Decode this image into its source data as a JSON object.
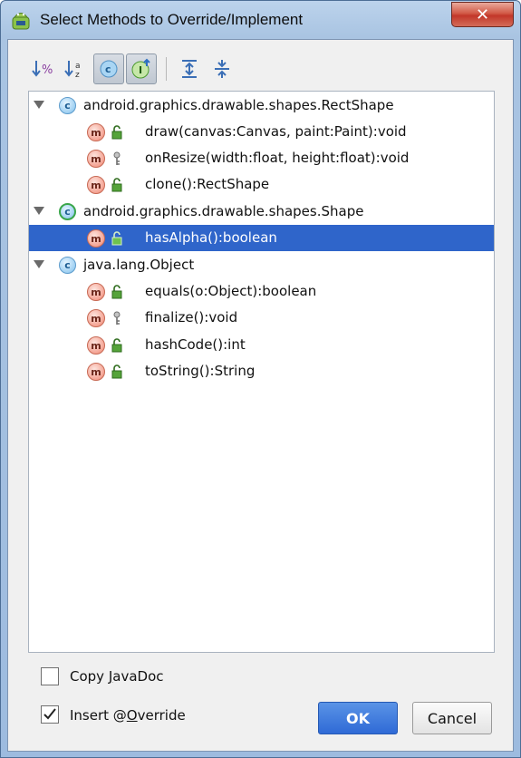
{
  "window": {
    "title": "Select Methods to Override/Implement",
    "close_symbol": "✕"
  },
  "toolbar": {
    "buttons": [
      {
        "name": "sort-by-visibility-button",
        "icon": "sort-visibility-icon",
        "toggled": false
      },
      {
        "name": "sort-alphabetically-button",
        "icon": "sort-alpha-icon",
        "toggled": false
      },
      {
        "name": "show-classes-button",
        "icon": "class-icon",
        "toggled": true
      },
      {
        "name": "show-interfaces-button",
        "icon": "interface-icon",
        "toggled": true
      },
      {
        "name": "expand-all-button",
        "icon": "expand-all-icon",
        "toggled": false
      },
      {
        "name": "collapse-all-button",
        "icon": "collapse-all-icon",
        "toggled": false
      }
    ]
  },
  "tree": {
    "groups": [
      {
        "class_name": "android.graphics.drawable.shapes.RectShape",
        "icon_letter": "c",
        "abstract": false,
        "methods": [
          {
            "signature": "draw(canvas:Canvas, paint:Paint):void",
            "visibility": "public"
          },
          {
            "signature": "onResize(width:float, height:float):void",
            "visibility": "protected"
          },
          {
            "signature": "clone():RectShape",
            "visibility": "public"
          }
        ]
      },
      {
        "class_name": "android.graphics.drawable.shapes.Shape",
        "icon_letter": "c",
        "abstract": true,
        "methods": [
          {
            "signature": "hasAlpha():boolean",
            "visibility": "public",
            "selected": true
          }
        ]
      },
      {
        "class_name": "java.lang.Object",
        "icon_letter": "c",
        "abstract": false,
        "methods": [
          {
            "signature": "equals(o:Object):boolean",
            "visibility": "public"
          },
          {
            "signature": "finalize():void",
            "visibility": "protected"
          },
          {
            "signature": "hashCode():int",
            "visibility": "public"
          },
          {
            "signature": "toString():String",
            "visibility": "public"
          }
        ]
      }
    ],
    "method_icon_letter": "m"
  },
  "options": {
    "copy_javadoc": {
      "label_pre": "Copy ",
      "label_mnemonic": "J",
      "label_post": "avaDoc",
      "checked": false
    },
    "insert_override": {
      "label_pre": "Insert @",
      "label_mnemonic": "O",
      "label_post": "verride",
      "checked": true
    }
  },
  "buttons": {
    "ok": "OK",
    "cancel": "Cancel"
  },
  "colors": {
    "selection": "#2f65ca",
    "ok_button": "#2f6ad6"
  }
}
